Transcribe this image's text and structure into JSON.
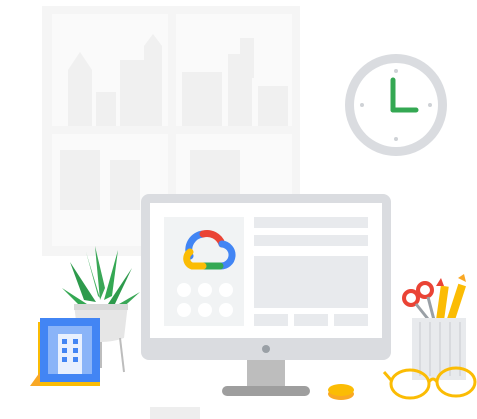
{
  "illustration": {
    "icons": {
      "window": "window-icon",
      "clock": "clock-icon",
      "plant": "plant-icon",
      "photo_frame": "framed-building-icon",
      "monitor": "monitor-icon",
      "logo": "google-cloud-logo-icon",
      "pencil_cup": "pencil-cup-icon",
      "glasses": "glasses-icon",
      "coin": "coin-icon"
    },
    "colors": {
      "blue": "#4285F4",
      "red": "#EA4335",
      "yellow": "#FBBC04",
      "green": "#34A853",
      "monitor_frame": "#DADCE0",
      "screen": "#F1F3F4",
      "wall_gray": "#EEEEEE"
    }
  }
}
